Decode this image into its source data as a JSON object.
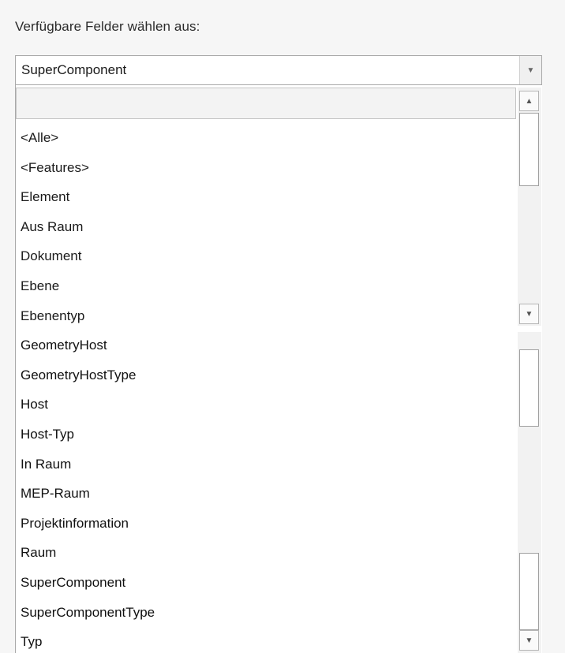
{
  "panel": {
    "label": "Verfügbare Felder wählen aus:"
  },
  "combo": {
    "value": "SuperComponent",
    "arrow_icon": "▼"
  },
  "dropdown": {
    "filter_value": "",
    "items": [
      "<Alle>",
      "<Features>",
      "Element",
      "Aus Raum",
      "Dokument",
      "Ebene",
      "Ebenentyp",
      "GeometryHost",
      "GeometryHostType",
      "Host",
      "Host-Typ",
      "In Raum",
      "MEP-Raum",
      "Projektinformation",
      "Raum",
      "SuperComponent",
      "SuperComponentType",
      "Typ"
    ]
  },
  "scrollbar": {
    "up_icon": "▲",
    "down_icon": "▼"
  }
}
